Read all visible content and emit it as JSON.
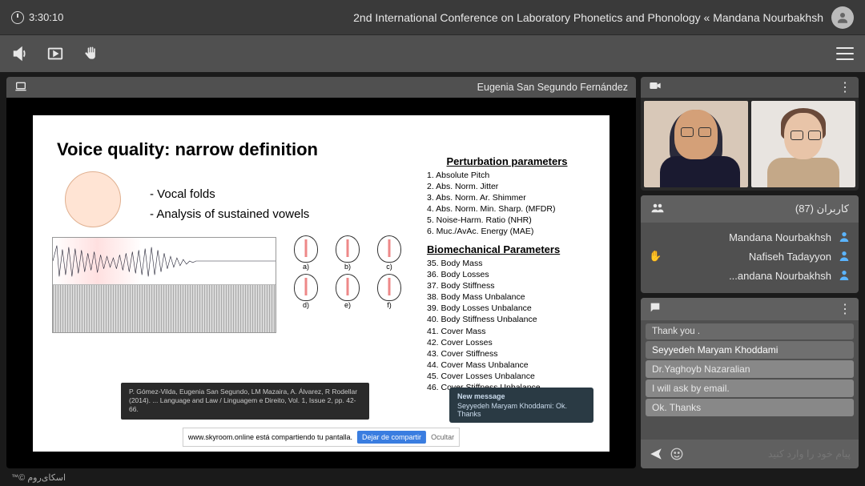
{
  "header": {
    "timer": "3:30:10",
    "title": "2nd International Conference on Laboratory Phonetics and Phonology « Mandana Nourbakhsh"
  },
  "share": {
    "presenter": "Eugenia San Segundo Fernández"
  },
  "slide": {
    "title": "Voice quality: narrow definition",
    "bullets": [
      "Vocal folds",
      "Analysis of sustained vowels"
    ],
    "perturbation_title": "Perturbation parameters",
    "perturbation": [
      "1. Absolute Pitch",
      "2. Abs. Norm. Jitter",
      "3. Abs. Norm. Ar. Shimmer",
      "4. Abs. Norm. Min. Sharp. (MFDR)",
      "5. Noise-Harm. Ratio (NHR)",
      "6. Muc./AvAc. Energy (MAE)"
    ],
    "bio_title": "Biomechanical Parameters",
    "bio": [
      "35. Body Mass",
      "36. Body Losses",
      "37. Body Stiffness",
      "38. Body Mass Unbalance",
      "39. Body Losses Unbalance",
      "40. Body Stiffness Unbalance",
      "41. Cover Mass",
      "42. Cover Losses",
      "43. Cover Stiffness",
      "44. Cover Mass Unbalance",
      "45. Cover Losses Unbalance",
      "46. Cover Stiffness Unbalance"
    ],
    "citation": "P. Gómez-Vilda, Eugenia San Segundo, LM Mazaira, A. Álvarez, R Rodellar (2014). ... Language and Law / Linguagem e Direito, Vol. 1, Issue 2, pp. 42-66.",
    "vocal_labels": [
      "a)",
      "b)",
      "c)",
      "d)",
      "e)",
      "f)"
    ],
    "notif_title": "New message",
    "notif_body": "Seyyedeh Maryam Khoddami: Ok. Thanks",
    "sharebar_text": "www.skyroom.online está compartiendo tu pantalla.",
    "sharebar_stop": "Dejar de compartir",
    "sharebar_hide": "Ocultar"
  },
  "users_panel": {
    "title": "کاربران (87)",
    "list": [
      {
        "name": "Mandana Nourbakhsh",
        "hand": false
      },
      {
        "name": "Nafiseh Tadayyon",
        "hand": true
      },
      {
        "name": "...andana Nourbakhsh",
        "hand": false
      }
    ]
  },
  "chat": {
    "messages": [
      {
        "cls": "others",
        "text": "Thank you ."
      },
      {
        "cls": "name",
        "text": "Seyyedeh Maryam Khoddami"
      },
      {
        "cls": "hl",
        "text": "Dr.Yaghoyb Nazaralian"
      },
      {
        "cls": "hl",
        "text": "I will ask by   email."
      },
      {
        "cls": "hl",
        "text": "Ok. Thanks"
      }
    ],
    "placeholder": "پیام خود را وارد کنید"
  },
  "footer": "اسکای‌روم ©"
}
